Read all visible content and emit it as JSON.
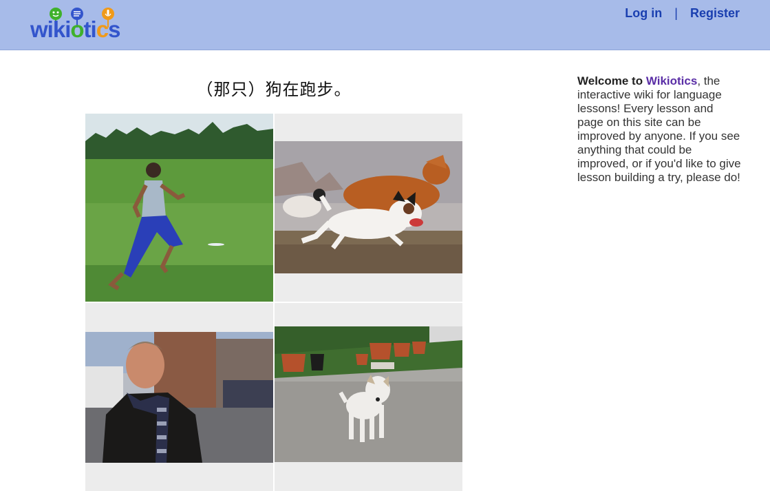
{
  "site": {
    "logo_text": "wikiotics",
    "logo_letters": [
      {
        "ch": "w",
        "color": "#3355cc"
      },
      {
        "ch": "i",
        "color": "#3355cc"
      },
      {
        "ch": "k",
        "color": "#3355cc"
      },
      {
        "ch": "i",
        "color": "#3355cc"
      },
      {
        "ch": "o",
        "color": "#3fb12b"
      },
      {
        "ch": "t",
        "color": "#3355cc"
      },
      {
        "ch": "i",
        "color": "#3355cc"
      },
      {
        "ch": "c",
        "color": "#f09a1a"
      },
      {
        "ch": "s",
        "color": "#3355cc"
      }
    ]
  },
  "nav": {
    "login_label": "Log in",
    "separator": "|",
    "register_label": "Register"
  },
  "lesson": {
    "sentence": "（那只）狗在跑步。",
    "images": [
      {
        "name": "image-boy-running",
        "subject": "boy running on grass"
      },
      {
        "name": "image-dog-running",
        "subject": "small dog running"
      },
      {
        "name": "image-man-scarf",
        "subject": "man in scarf on street"
      },
      {
        "name": "image-dog-standing",
        "subject": "dog standing near pots"
      }
    ]
  },
  "sidebar": {
    "welcome_prefix": "Welcome to ",
    "brand": "Wikiotics",
    "body": ", the interactive wiki for language lessons! Every lesson and page on this site can be improved by anyone. If you see anything that could be improved, or if you'd like to give lesson building a try, please do!"
  },
  "colors": {
    "header_bg": "#a7bbe9",
    "link": "#1a3fb0",
    "brand": "#5a2ea6",
    "cell_bg": "#ececec"
  }
}
